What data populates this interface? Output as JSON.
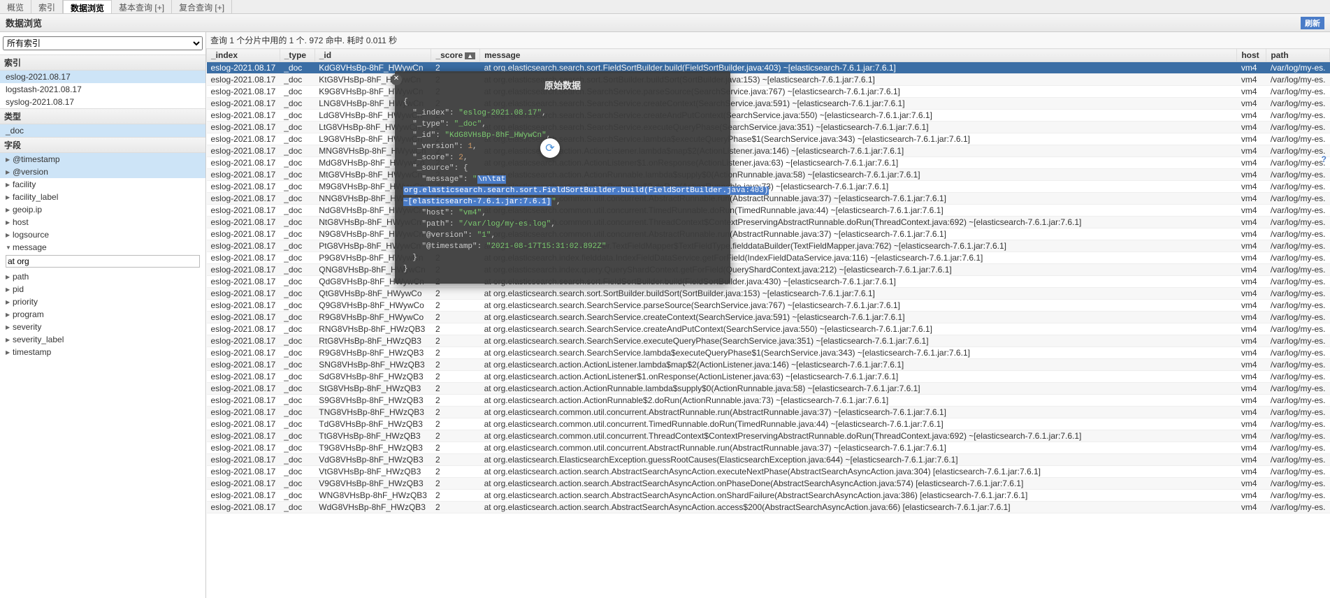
{
  "tabs": {
    "t1": "概览",
    "t2": "索引",
    "t3": "数据浏览",
    "t4": "基本查询 [+]",
    "t5": "复合查询 [+]"
  },
  "page_title": "数据浏览",
  "refresh": "刷新",
  "sidebar": {
    "allIndices": "所有索引",
    "secIndices": "索引",
    "indices": [
      "eslog-2021.08.17",
      "logstash-2021.08.17",
      "syslog-2021.08.17"
    ],
    "secTypes": "类型",
    "types": [
      "_doc"
    ],
    "secFields": "字段",
    "fields": [
      "@timestamp",
      "@version",
      "facility",
      "facility_label",
      "geoip.ip",
      "host",
      "logsource",
      "message",
      "path",
      "pid",
      "priority",
      "program",
      "severity",
      "severity_label",
      "timestamp"
    ],
    "filterValue": "at org"
  },
  "resultInfo": "查询 1 个分片中用的 1 个. 972 命中. 耗时 0.011 秒",
  "columns": {
    "index": "_index",
    "type": "_type",
    "id": "_id",
    "score": "_score",
    "message": "message",
    "host": "host",
    "path": "path",
    "sortAsc": "▲"
  },
  "rows": [
    {
      "idx": "eslog-2021.08.17",
      "type": "_doc",
      "id": "KdG8VHsBp-8hF_HWywCn",
      "score": "2",
      "msg": "at org.elasticsearch.search.sort.FieldSortBuilder.build(FieldSortBuilder.java:403) ~[elasticsearch-7.6.1.jar:7.6.1]",
      "host": "vm4",
      "path": "/var/log/my-es."
    },
    {
      "idx": "eslog-2021.08.17",
      "type": "_doc",
      "id": "KtG8VHsBp-8hF_HWywCn",
      "score": "2",
      "msg": "at org.elasticsearch.search.sort.SortBuilder.buildSort(SortBuilder.java:153) ~[elasticsearch-7.6.1.jar:7.6.1]",
      "host": "vm4",
      "path": "/var/log/my-es."
    },
    {
      "idx": "eslog-2021.08.17",
      "type": "_doc",
      "id": "K9G8VHsBp-8hF_HWywCn",
      "score": "2",
      "msg": "at org.elasticsearch.search.SearchService.parseSource(SearchService.java:767) ~[elasticsearch-7.6.1.jar:7.6.1]",
      "host": "vm4",
      "path": "/var/log/my-es."
    },
    {
      "idx": "eslog-2021.08.17",
      "type": "_doc",
      "id": "LNG8VHsBp-8hF_HWywCn",
      "score": "2",
      "msg": "at org.elasticsearch.search.SearchService.createContext(SearchService.java:591) ~[elasticsearch-7.6.1.jar:7.6.1]",
      "host": "vm4",
      "path": "/var/log/my-es."
    },
    {
      "idx": "eslog-2021.08.17",
      "type": "_doc",
      "id": "LdG8VHsBp-8hF_HWywCn",
      "score": "2",
      "msg": "at org.elasticsearch.search.SearchService.createAndPutContext(SearchService.java:550) ~[elasticsearch-7.6.1.jar:7.6.1]",
      "host": "vm4",
      "path": "/var/log/my-es."
    },
    {
      "idx": "eslog-2021.08.17",
      "type": "_doc",
      "id": "LtG8VHsBp-8hF_HWywCn",
      "score": "2",
      "msg": "at org.elasticsearch.search.SearchService.executeQueryPhase(SearchService.java:351) ~[elasticsearch-7.6.1.jar:7.6.1]",
      "host": "vm4",
      "path": "/var/log/my-es."
    },
    {
      "idx": "eslog-2021.08.17",
      "type": "_doc",
      "id": "L9G8VHsBp-8hF_HWywCn",
      "score": "2",
      "msg": "at org.elasticsearch.search.SearchService.lambda$executeQueryPhase$1(SearchService.java:343) ~[elasticsearch-7.6.1.jar:7.6.1]",
      "host": "vm4",
      "path": "/var/log/my-es."
    },
    {
      "idx": "eslog-2021.08.17",
      "type": "_doc",
      "id": "MNG8VHsBp-8hF_HWywCn",
      "score": "2",
      "msg": "at org.elasticsearch.action.ActionListener.lambda$map$2(ActionListener.java:146) ~[elasticsearch-7.6.1.jar:7.6.1]",
      "host": "vm4",
      "path": "/var/log/my-es."
    },
    {
      "idx": "eslog-2021.08.17",
      "type": "_doc",
      "id": "MdG8VHsBp-8hF_HWywCn",
      "score": "2",
      "msg": "at org.elasticsearch.action.ActionListener$1.onResponse(ActionListener.java:63) ~[elasticsearch-7.6.1.jar:7.6.1]",
      "host": "vm4",
      "path": "/var/log/my-es."
    },
    {
      "idx": "eslog-2021.08.17",
      "type": "_doc",
      "id": "MtG8VHsBp-8hF_HWywCn",
      "score": "2",
      "msg": "at org.elasticsearch.action.ActionRunnable.lambda$supply$0(ActionRunnable.java:58) ~[elasticsearch-7.6.1.jar:7.6.1]",
      "host": "vm4",
      "path": "/var/log/my-es."
    },
    {
      "idx": "eslog-2021.08.17",
      "type": "_doc",
      "id": "M9G8VHsBp-8hF_HWywCn",
      "score": "2",
      "msg": "at org.elasticsearch.action.ActionRunnable$2.doRun(ActionRunnable.java:73) ~[elasticsearch-7.6.1.jar:7.6.1]",
      "host": "vm4",
      "path": "/var/log/my-es."
    },
    {
      "idx": "eslog-2021.08.17",
      "type": "_doc",
      "id": "NNG8VHsBp-8hF_HWywCn",
      "score": "2",
      "msg": "at org.elasticsearch.common.util.concurrent.AbstractRunnable.run(AbstractRunnable.java:37) ~[elasticsearch-7.6.1.jar:7.6.1]",
      "host": "vm4",
      "path": "/var/log/my-es."
    },
    {
      "idx": "eslog-2021.08.17",
      "type": "_doc",
      "id": "NdG8VHsBp-8hF_HWywCn",
      "score": "2",
      "msg": "at org.elasticsearch.common.util.concurrent.TimedRunnable.doRun(TimedRunnable.java:44) ~[elasticsearch-7.6.1.jar:7.6.1]",
      "host": "vm4",
      "path": "/var/log/my-es."
    },
    {
      "idx": "eslog-2021.08.17",
      "type": "_doc",
      "id": "NtG8VHsBp-8hF_HWywCn",
      "score": "2",
      "msg": "at org.elasticsearch.common.util.concurrent.ThreadContext$ContextPreservingAbstractRunnable.doRun(ThreadContext.java:692) ~[elasticsearch-7.6.1.jar:7.6.1]",
      "host": "vm4",
      "path": "/var/log/my-es."
    },
    {
      "idx": "eslog-2021.08.17",
      "type": "_doc",
      "id": "N9G8VHsBp-8hF_HWywCn",
      "score": "2",
      "msg": "at org.elasticsearch.common.util.concurrent.AbstractRunnable.run(AbstractRunnable.java:37) ~[elasticsearch-7.6.1.jar:7.6.1]",
      "host": "vm4",
      "path": "/var/log/my-es."
    },
    {
      "idx": "eslog-2021.08.17",
      "type": "_doc",
      "id": "PtG8VHsBp-8hF_HWywCn",
      "score": "2",
      "msg": "at org.elasticsearch.index.mapper.TextFieldMapper$TextFieldType.fielddataBuilder(TextFieldMapper.java:762) ~[elasticsearch-7.6.1.jar:7.6.1]",
      "host": "vm4",
      "path": "/var/log/my-es."
    },
    {
      "idx": "eslog-2021.08.17",
      "type": "_doc",
      "id": "P9G8VHsBp-8hF_HWywCn",
      "score": "2",
      "msg": "at org.elasticsearch.index.fielddata.IndexFieldDataService.getForField(IndexFieldDataService.java:116) ~[elasticsearch-7.6.1.jar:7.6.1]",
      "host": "vm4",
      "path": "/var/log/my-es."
    },
    {
      "idx": "eslog-2021.08.17",
      "type": "_doc",
      "id": "QNG8VHsBp-8hF_HWywCn",
      "score": "2",
      "msg": "at org.elasticsearch.index.query.QueryShardContext.getForField(QueryShardContext.java:212) ~[elasticsearch-7.6.1.jar:7.6.1]",
      "host": "vm4",
      "path": "/var/log/my-es."
    },
    {
      "idx": "eslog-2021.08.17",
      "type": "_doc",
      "id": "QdG8VHsBp-8hF_HWywCn",
      "score": "2",
      "msg": "at org.elasticsearch.search.sort.FieldSortBuilder.build(FieldSortBuilder.java:430) ~[elasticsearch-7.6.1.jar:7.6.1]",
      "host": "vm4",
      "path": "/var/log/my-es."
    },
    {
      "idx": "eslog-2021.08.17",
      "type": "_doc",
      "id": "QtG8VHsBp-8hF_HWywCo",
      "score": "2",
      "msg": "at org.elasticsearch.search.sort.SortBuilder.buildSort(SortBuilder.java:153) ~[elasticsearch-7.6.1.jar:7.6.1]",
      "host": "vm4",
      "path": "/var/log/my-es."
    },
    {
      "idx": "eslog-2021.08.17",
      "type": "_doc",
      "id": "Q9G8VHsBp-8hF_HWywCo",
      "score": "2",
      "msg": "at org.elasticsearch.search.SearchService.parseSource(SearchService.java:767) ~[elasticsearch-7.6.1.jar:7.6.1]",
      "host": "vm4",
      "path": "/var/log/my-es."
    },
    {
      "idx": "eslog-2021.08.17",
      "type": "_doc",
      "id": "R9G8VHsBp-8hF_HWywCo",
      "score": "2",
      "msg": "at org.elasticsearch.search.SearchService.createContext(SearchService.java:591) ~[elasticsearch-7.6.1.jar:7.6.1]",
      "host": "vm4",
      "path": "/var/log/my-es."
    },
    {
      "idx": "eslog-2021.08.17",
      "type": "_doc",
      "id": "RNG8VHsBp-8hF_HWzQB3",
      "score": "2",
      "msg": "at org.elasticsearch.search.SearchService.createAndPutContext(SearchService.java:550) ~[elasticsearch-7.6.1.jar:7.6.1]",
      "host": "vm4",
      "path": "/var/log/my-es."
    },
    {
      "idx": "eslog-2021.08.17",
      "type": "_doc",
      "id": "RtG8VHsBp-8hF_HWzQB3",
      "score": "2",
      "msg": "at org.elasticsearch.search.SearchService.executeQueryPhase(SearchService.java:351) ~[elasticsearch-7.6.1.jar:7.6.1]",
      "host": "vm4",
      "path": "/var/log/my-es."
    },
    {
      "idx": "eslog-2021.08.17",
      "type": "_doc",
      "id": "R9G8VHsBp-8hF_HWzQB3",
      "score": "2",
      "msg": "at org.elasticsearch.search.SearchService.lambda$executeQueryPhase$1(SearchService.java:343) ~[elasticsearch-7.6.1.jar:7.6.1]",
      "host": "vm4",
      "path": "/var/log/my-es."
    },
    {
      "idx": "eslog-2021.08.17",
      "type": "_doc",
      "id": "SNG8VHsBp-8hF_HWzQB3",
      "score": "2",
      "msg": "at org.elasticsearch.action.ActionListener.lambda$map$2(ActionListener.java:146) ~[elasticsearch-7.6.1.jar:7.6.1]",
      "host": "vm4",
      "path": "/var/log/my-es."
    },
    {
      "idx": "eslog-2021.08.17",
      "type": "_doc",
      "id": "SdG8VHsBp-8hF_HWzQB3",
      "score": "2",
      "msg": "at org.elasticsearch.action.ActionListener$1.onResponse(ActionListener.java:63) ~[elasticsearch-7.6.1.jar:7.6.1]",
      "host": "vm4",
      "path": "/var/log/my-es."
    },
    {
      "idx": "eslog-2021.08.17",
      "type": "_doc",
      "id": "StG8VHsBp-8hF_HWzQB3",
      "score": "2",
      "msg": "at org.elasticsearch.action.ActionRunnable.lambda$supply$0(ActionRunnable.java:58) ~[elasticsearch-7.6.1.jar:7.6.1]",
      "host": "vm4",
      "path": "/var/log/my-es."
    },
    {
      "idx": "eslog-2021.08.17",
      "type": "_doc",
      "id": "S9G8VHsBp-8hF_HWzQB3",
      "score": "2",
      "msg": "at org.elasticsearch.action.ActionRunnable$2.doRun(ActionRunnable.java:73) ~[elasticsearch-7.6.1.jar:7.6.1]",
      "host": "vm4",
      "path": "/var/log/my-es."
    },
    {
      "idx": "eslog-2021.08.17",
      "type": "_doc",
      "id": "TNG8VHsBp-8hF_HWzQB3",
      "score": "2",
      "msg": "at org.elasticsearch.common.util.concurrent.AbstractRunnable.run(AbstractRunnable.java:37) ~[elasticsearch-7.6.1.jar:7.6.1]",
      "host": "vm4",
      "path": "/var/log/my-es."
    },
    {
      "idx": "eslog-2021.08.17",
      "type": "_doc",
      "id": "TdG8VHsBp-8hF_HWzQB3",
      "score": "2",
      "msg": "at org.elasticsearch.common.util.concurrent.TimedRunnable.doRun(TimedRunnable.java:44) ~[elasticsearch-7.6.1.jar:7.6.1]",
      "host": "vm4",
      "path": "/var/log/my-es."
    },
    {
      "idx": "eslog-2021.08.17",
      "type": "_doc",
      "id": "TtG8VHsBp-8hF_HWzQB3",
      "score": "2",
      "msg": "at org.elasticsearch.common.util.concurrent.ThreadContext$ContextPreservingAbstractRunnable.doRun(ThreadContext.java:692) ~[elasticsearch-7.6.1.jar:7.6.1]",
      "host": "vm4",
      "path": "/var/log/my-es."
    },
    {
      "idx": "eslog-2021.08.17",
      "type": "_doc",
      "id": "T9G8VHsBp-8hF_HWzQB3",
      "score": "2",
      "msg": "at org.elasticsearch.common.util.concurrent.AbstractRunnable.run(AbstractRunnable.java:37) ~[elasticsearch-7.6.1.jar:7.6.1]",
      "host": "vm4",
      "path": "/var/log/my-es."
    },
    {
      "idx": "eslog-2021.08.17",
      "type": "_doc",
      "id": "VdG8VHsBp-8hF_HWzQB3",
      "score": "2",
      "msg": "at org.elasticsearch.ElasticsearchException.guessRootCauses(ElasticsearchException.java:644) ~[elasticsearch-7.6.1.jar:7.6.1]",
      "host": "vm4",
      "path": "/var/log/my-es."
    },
    {
      "idx": "eslog-2021.08.17",
      "type": "_doc",
      "id": "VtG8VHsBp-8hF_HWzQB3",
      "score": "2",
      "msg": "at org.elasticsearch.action.search.AbstractSearchAsyncAction.executeNextPhase(AbstractSearchAsyncAction.java:304) [elasticsearch-7.6.1.jar:7.6.1]",
      "host": "vm4",
      "path": "/var/log/my-es."
    },
    {
      "idx": "eslog-2021.08.17",
      "type": "_doc",
      "id": "V9G8VHsBp-8hF_HWzQB3",
      "score": "2",
      "msg": "at org.elasticsearch.action.search.AbstractSearchAsyncAction.onPhaseDone(AbstractSearchAsyncAction.java:574) [elasticsearch-7.6.1.jar:7.6.1]",
      "host": "vm4",
      "path": "/var/log/my-es."
    },
    {
      "idx": "eslog-2021.08.17",
      "type": "_doc",
      "id": "WNG8VHsBp-8hF_HWzQB3",
      "score": "2",
      "msg": "at org.elasticsearch.action.search.AbstractSearchAsyncAction.onShardFailure(AbstractSearchAsyncAction.java:386) [elasticsearch-7.6.1.jar:7.6.1]",
      "host": "vm4",
      "path": "/var/log/my-es."
    },
    {
      "idx": "eslog-2021.08.17",
      "type": "_doc",
      "id": "WdG8VHsBp-8hF_HWzQB3",
      "score": "2",
      "msg": "at org.elasticsearch.action.search.AbstractSearchAsyncAction.access$200(AbstractSearchAsyncAction.java:66) [elasticsearch-7.6.1.jar:7.6.1]",
      "host": "vm4",
      "path": "/var/log/my-es."
    }
  ],
  "tooltip": {
    "title": "原始数据",
    "index": "eslog-2021.08.17",
    "type": "_doc",
    "id": "KdG8VHsBp-8hF_HWywCn",
    "score": "2",
    "msg_pre": "\\n\\tat ",
    "msg_hl": "org.elasticsearch.search.sort.FieldSortBuilder.build(FieldSortBuilder.java:403) ~[elasticsearch-7.6.1.jar:7.6.1]",
    "host": "vm4",
    "path": "/var/log/my-es.log",
    "version": "1",
    "timestamp": "2021-08-17T15:31:02.892Z"
  }
}
